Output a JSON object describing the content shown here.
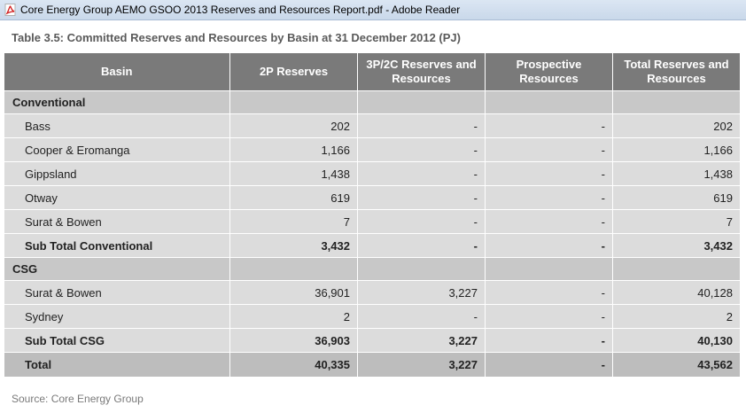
{
  "window": {
    "title": "Core Energy Group AEMO GSOO 2013 Reserves and Resources Report.pdf - Adobe Reader"
  },
  "caption": "Table 3.5: Committed Reserves and Resources by Basin at 31 December 2012 (PJ)",
  "table": {
    "headers": [
      "Basin",
      "2P Reserves",
      "3P/2C Reserves and Resources",
      "Prospective Resources",
      "Total Reserves and Resources"
    ],
    "sections": [
      {
        "name": "Conventional",
        "rows": [
          {
            "basin": "Bass",
            "p2": "202",
            "p3": "-",
            "prospective": "-",
            "total": "202"
          },
          {
            "basin": "Cooper & Eromanga",
            "p2": "1,166",
            "p3": "-",
            "prospective": "-",
            "total": "1,166"
          },
          {
            "basin": "Gippsland",
            "p2": "1,438",
            "p3": "-",
            "prospective": "-",
            "total": "1,438"
          },
          {
            "basin": "Otway",
            "p2": "619",
            "p3": "-",
            "prospective": "-",
            "total": "619"
          },
          {
            "basin": "Surat & Bowen",
            "p2": "7",
            "p3": "-",
            "prospective": "-",
            "total": "7"
          }
        ],
        "subtotal": {
          "basin": "Sub Total Conventional",
          "p2": "3,432",
          "p3": "-",
          "prospective": "-",
          "total": "3,432"
        }
      },
      {
        "name": "CSG",
        "rows": [
          {
            "basin": "Surat & Bowen",
            "p2": "36,901",
            "p3": "3,227",
            "prospective": "-",
            "total": "40,128"
          },
          {
            "basin": "Sydney",
            "p2": "2",
            "p3": "-",
            "prospective": "-",
            "total": "2"
          }
        ],
        "subtotal": {
          "basin": "Sub Total CSG",
          "p2": "36,903",
          "p3": "3,227",
          "prospective": "-",
          "total": "40,130"
        }
      }
    ],
    "total": {
      "basin": "Total",
      "p2": "40,335",
      "p3": "3,227",
      "prospective": "-",
      "total": "43,562"
    }
  },
  "source": "Source: Core Energy Group",
  "icons": {
    "app": "pdf-icon"
  },
  "colors": {
    "header_bg": "#7a7a7a",
    "row_bg": "#dcdcdc",
    "section_bg": "#c8c8c8",
    "total_bg": "#bdbdbd"
  }
}
